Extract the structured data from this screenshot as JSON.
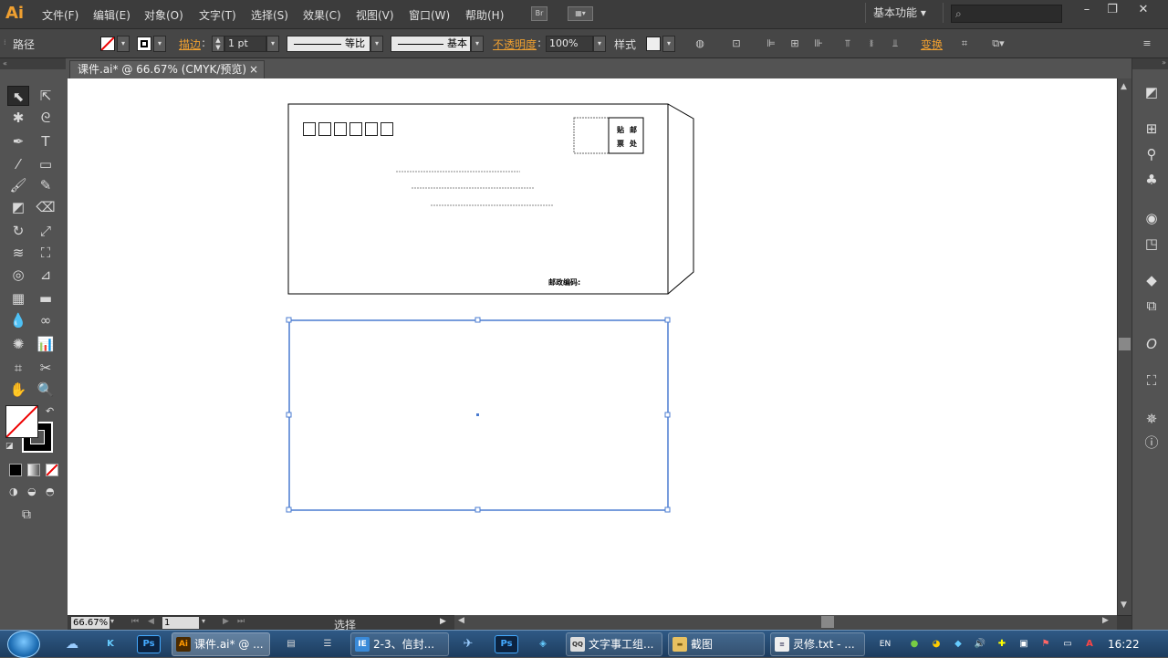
{
  "app": {
    "logo": "Ai"
  },
  "menu": [
    "文件(F)",
    "编辑(E)",
    "对象(O)",
    "文字(T)",
    "选择(S)",
    "效果(C)",
    "视图(V)",
    "窗口(W)",
    "帮助(H)"
  ],
  "menubar_icons": {
    "bridge": "Br",
    "arrange": "arrange-documents-icon"
  },
  "workspace": "基本功能",
  "search": {
    "placeholder": ""
  },
  "window_controls": {
    "minimize": "–",
    "restore": "❐",
    "close": "✕"
  },
  "control_bar": {
    "selection_type": "路径",
    "stroke_label": "描边",
    "stroke_weight": "1 pt",
    "profile_label": "等比",
    "brush_label": "基本",
    "opacity_label": "不透明度",
    "opacity_value": "100%",
    "style_label": "样式",
    "transform_label": "变换"
  },
  "document": {
    "tab_title": "课件.ai* @ 66.67% (CMYK/预览)",
    "close_symbol": "×"
  },
  "envelope": {
    "stamp_text": [
      "贴",
      "邮",
      "票",
      "处"
    ],
    "postal_code_label": "邮政编码:",
    "zip_box_count": 6
  },
  "status_bar": {
    "zoom": "66.67%",
    "artboard": "1",
    "status_text": "选择"
  },
  "taskbar": {
    "buttons": [
      {
        "label": "课件.ai* @ ...",
        "icon": "Ai"
      },
      {
        "label": "2-3、信封...",
        "icon": "IE"
      },
      {
        "label": "文字事工组...",
        "icon": "QQ"
      },
      {
        "label": "截图",
        "icon": "folder"
      },
      {
        "label": "灵修.txt - ...",
        "icon": "txt"
      }
    ],
    "language": "EN",
    "clock": "16:22"
  }
}
